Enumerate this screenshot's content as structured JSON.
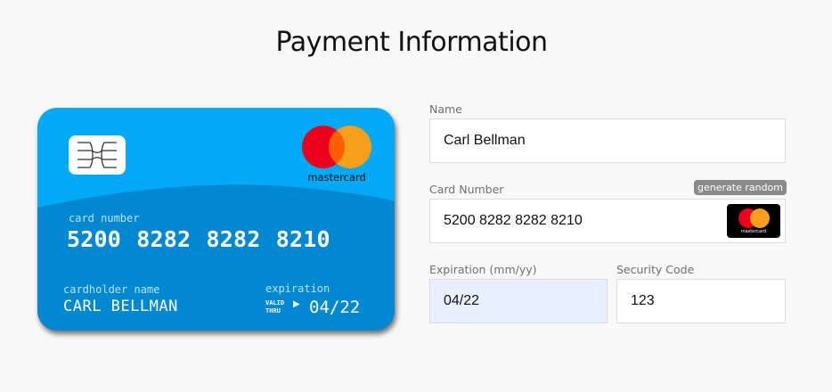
{
  "page": {
    "title": "Payment Information"
  },
  "card": {
    "brand": "mastercard",
    "number_label": "card number",
    "number": "5200 8282 8282 8210",
    "holder_label": "cardholder name",
    "holder_name": "CARL BELLMAN",
    "expiration_label": "expiration",
    "valid_thru_line1": "VALID",
    "valid_thru_line2": "THRU",
    "expiration_value": "04/22",
    "colors": {
      "base": "#03a9f4",
      "wave": "#0288d1",
      "mc_red": "#eb001b",
      "mc_orange": "#f79e1b"
    }
  },
  "form": {
    "name_label": "Name",
    "name_value": "Carl Bellman",
    "card_number_label": "Card Number",
    "generate_random_label": "generate random",
    "card_number_value": "5200 8282 8282 8210",
    "card_brand_badge": "mastercard",
    "expiration_label": "Expiration (mm/yy)",
    "expiration_value": "04/22",
    "security_code_label": "Security Code",
    "security_code_value": "123"
  }
}
